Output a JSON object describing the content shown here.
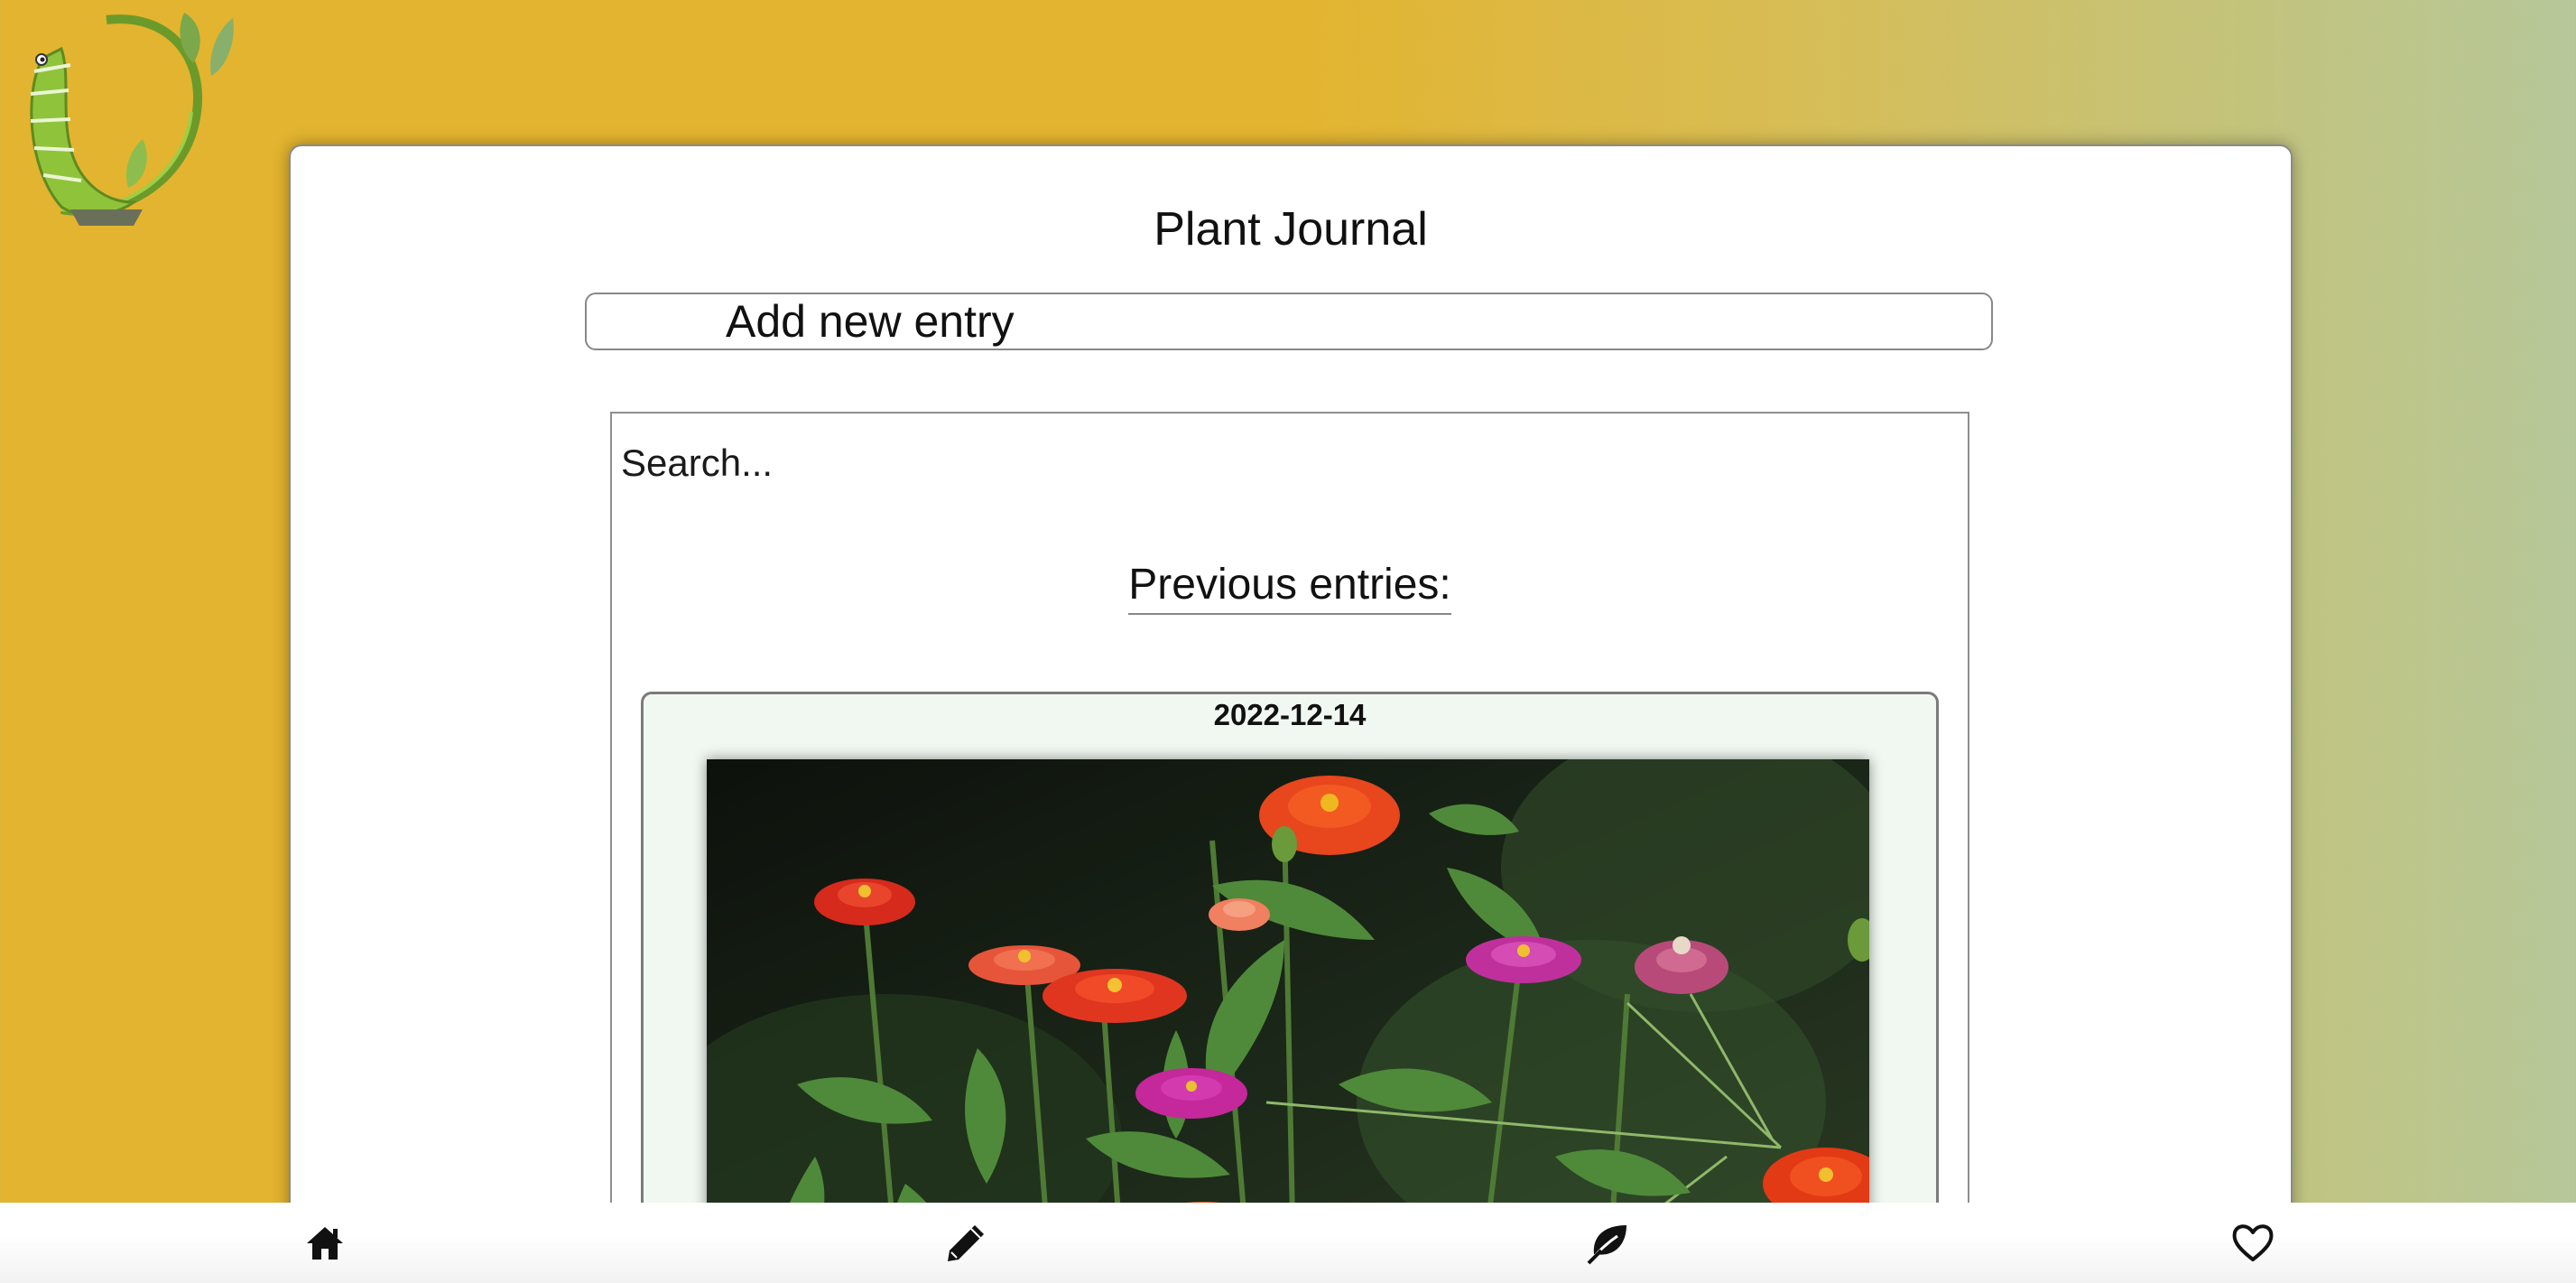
{
  "app": {
    "title": "Plant Journal",
    "logo_icon": "vine-logo-icon"
  },
  "add_entry": {
    "label": "Add new entry"
  },
  "search": {
    "placeholder": "Search..."
  },
  "entries": {
    "heading": "Previous entries:",
    "items": [
      {
        "date": "2022-12-14",
        "photo": "zinnia-flowers-photo"
      }
    ]
  },
  "nav": {
    "items": [
      {
        "name": "home",
        "icon": "home-icon"
      },
      {
        "name": "new-entry",
        "icon": "pencil-icon"
      },
      {
        "name": "plants",
        "icon": "leaf-icon"
      },
      {
        "name": "favorites",
        "icon": "heart-icon"
      }
    ]
  },
  "colors": {
    "background_left": "#e3b42f",
    "background_right": "#b6c79a",
    "card_bg": "#ffffff",
    "entry_bg": "#f1f7f1"
  }
}
